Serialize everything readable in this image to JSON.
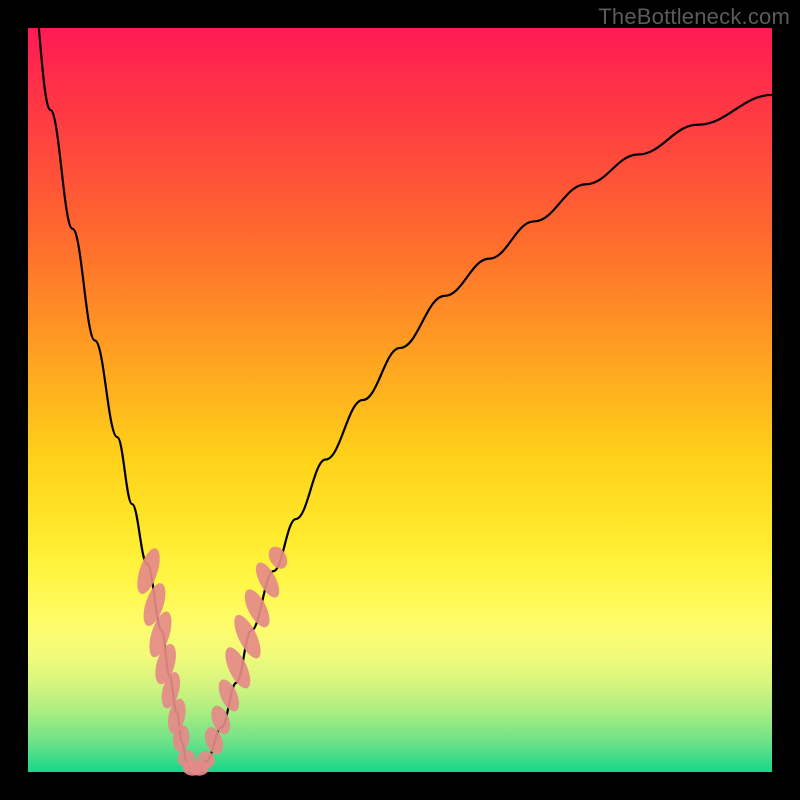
{
  "watermark": "TheBottleneck.com",
  "chart_data": {
    "type": "line",
    "title": "",
    "xlabel": "",
    "ylabel": "",
    "xlim": [
      0,
      100
    ],
    "ylim": [
      0,
      100
    ],
    "grid": false,
    "series": [
      {
        "name": "curve",
        "x": [
          0,
          3,
          6,
          9,
          12,
          14,
          16,
          18,
          19,
          20,
          20.7,
          21.3,
          22,
          23,
          24,
          26,
          28,
          30,
          33,
          36,
          40,
          45,
          50,
          56,
          62,
          68,
          75,
          82,
          90,
          100
        ],
        "y": [
          110,
          89,
          73,
          58,
          45,
          36,
          28,
          19,
          13,
          8,
          4,
          1.5,
          0.3,
          0.3,
          1.5,
          6,
          12,
          19,
          27,
          34,
          42,
          50,
          57,
          64,
          69,
          74,
          79,
          83,
          87,
          91
        ]
      }
    ],
    "markers": [
      {
        "cx": 16.2,
        "cy": 27.0,
        "rx": 1.2,
        "ry": 3.2,
        "rot": 18
      },
      {
        "cx": 17.0,
        "cy": 22.5,
        "rx": 1.2,
        "ry": 3.0,
        "rot": 18
      },
      {
        "cx": 17.8,
        "cy": 18.5,
        "rx": 1.2,
        "ry": 3.2,
        "rot": 17
      },
      {
        "cx": 18.5,
        "cy": 14.5,
        "rx": 1.2,
        "ry": 2.8,
        "rot": 16
      },
      {
        "cx": 19.2,
        "cy": 11.0,
        "rx": 1.1,
        "ry": 2.5,
        "rot": 15
      },
      {
        "cx": 20.0,
        "cy": 7.5,
        "rx": 1.1,
        "ry": 2.4,
        "rot": 12
      },
      {
        "cx": 20.6,
        "cy": 4.5,
        "rx": 1.1,
        "ry": 1.8,
        "rot": 8
      },
      {
        "cx": 21.3,
        "cy": 1.8,
        "rx": 1.2,
        "ry": 1.2,
        "rot": 0
      },
      {
        "cx": 22.1,
        "cy": 0.5,
        "rx": 1.3,
        "ry": 1.0,
        "rot": 0
      },
      {
        "cx": 23.0,
        "cy": 0.5,
        "rx": 1.3,
        "ry": 1.0,
        "rot": 0
      },
      {
        "cx": 23.9,
        "cy": 1.6,
        "rx": 1.2,
        "ry": 1.2,
        "rot": 0
      },
      {
        "cx": 25.0,
        "cy": 4.2,
        "rx": 1.1,
        "ry": 1.9,
        "rot": -20
      },
      {
        "cx": 25.9,
        "cy": 7.0,
        "rx": 1.1,
        "ry": 2.0,
        "rot": -22
      },
      {
        "cx": 27.0,
        "cy": 10.3,
        "rx": 1.1,
        "ry": 2.3,
        "rot": -24
      },
      {
        "cx": 28.2,
        "cy": 14.0,
        "rx": 1.2,
        "ry": 3.0,
        "rot": -25
      },
      {
        "cx": 29.5,
        "cy": 18.2,
        "rx": 1.2,
        "ry": 3.2,
        "rot": -26
      },
      {
        "cx": 30.8,
        "cy": 22.0,
        "rx": 1.2,
        "ry": 2.8,
        "rot": -27
      },
      {
        "cx": 32.2,
        "cy": 25.8,
        "rx": 1.1,
        "ry": 2.6,
        "rot": -28
      },
      {
        "cx": 33.6,
        "cy": 28.8,
        "rx": 1.1,
        "ry": 1.6,
        "rot": -30
      }
    ]
  }
}
